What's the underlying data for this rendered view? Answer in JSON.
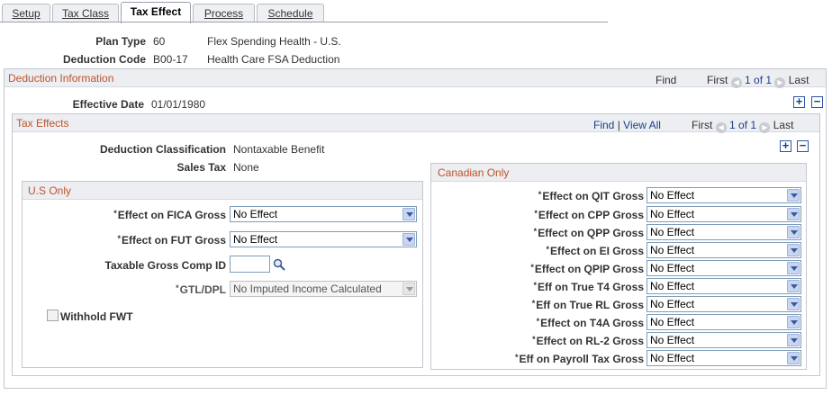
{
  "tabs": [
    {
      "label": "Setup"
    },
    {
      "label": "Tax Class"
    },
    {
      "label": "Tax Effect"
    },
    {
      "label": "Process"
    },
    {
      "label": "Schedule"
    }
  ],
  "header": {
    "plan_type_label": "Plan Type",
    "plan_type_code": "60",
    "plan_type_desc": "Flex Spending Health - U.S.",
    "deduction_code_label": "Deduction Code",
    "deduction_code_value": "B00-17",
    "deduction_code_desc": "Health Care FSA Deduction"
  },
  "deduction_info": {
    "title": "Deduction Information",
    "find": "Find",
    "first": "First",
    "range": "1 of 1",
    "last": "Last",
    "effective_date_label": "Effective Date",
    "effective_date_value": "01/01/1980"
  },
  "tax_effects": {
    "title": "Tax Effects",
    "find": "Find",
    "separator": "|",
    "view_all": "View All",
    "first": "First",
    "range": "1 of 1",
    "last": "Last",
    "classification_label": "Deduction Classification",
    "classification_value": "Nontaxable Benefit",
    "sales_tax_label": "Sales Tax",
    "sales_tax_value": "None"
  },
  "us_only": {
    "title": "U.S Only",
    "fica_label": "Effect on FICA Gross",
    "fica_value": "No Effect",
    "fut_label": "Effect on FUT Gross",
    "fut_value": "No Effect",
    "taxable_gross_label": "Taxable Gross Comp ID",
    "taxable_gross_value": "",
    "gtl_label": "GTL/DPL",
    "gtl_value": "No Imputed Income Calculated",
    "withhold_label": "Withhold FWT",
    "required_marker": "*"
  },
  "canadian_only": {
    "title": "Canadian Only",
    "rows": [
      {
        "label": "Effect on QIT Gross",
        "value": "No Effect"
      },
      {
        "label": "Effect on CPP Gross",
        "value": "No Effect"
      },
      {
        "label": "Effect on QPP Gross",
        "value": "No Effect"
      },
      {
        "label": "Effect on EI Gross",
        "value": "No Effect"
      },
      {
        "label": "Effect on QPIP Gross",
        "value": "No Effect"
      },
      {
        "label": "Eff on True T4 Gross",
        "value": "No Effect"
      },
      {
        "label": "Eff on True RL Gross",
        "value": "No Effect"
      },
      {
        "label": "Effect on T4A Gross",
        "value": "No Effect"
      },
      {
        "label": "Effect on RL-2 Gross",
        "value": "No Effect"
      },
      {
        "label": "Eff on Payroll Tax Gross",
        "value": "No Effect"
      }
    ]
  },
  "icons": {
    "prev": "chevron-left-icon",
    "next": "chevron-right-icon",
    "add": "plus-icon",
    "remove": "minus-icon",
    "lookup": "magnifier-icon"
  },
  "colors": {
    "section_title": "#c0532a",
    "link": "#1b3f8b",
    "header_bg": "#eceef2"
  }
}
